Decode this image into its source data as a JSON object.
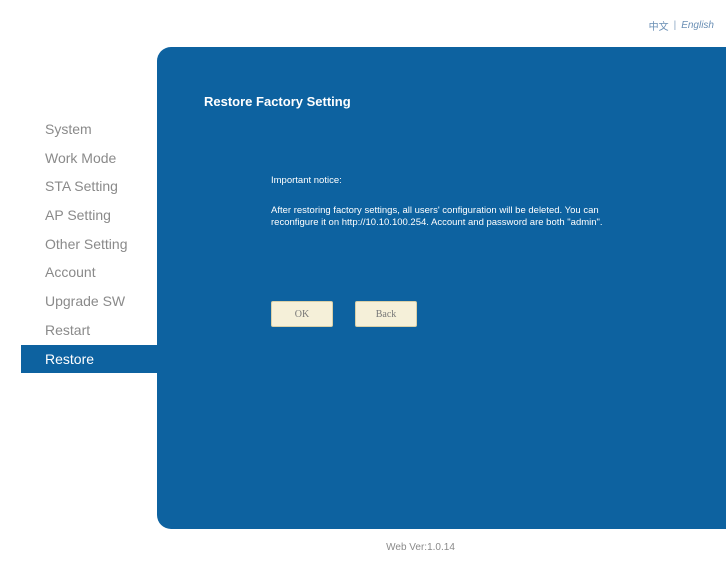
{
  "header": {
    "lang_zh": "中文",
    "separator": "|",
    "lang_en": "English"
  },
  "sidebar": {
    "items": [
      {
        "label": "System"
      },
      {
        "label": "Work Mode"
      },
      {
        "label": "STA Setting"
      },
      {
        "label": "AP Setting"
      },
      {
        "label": "Other Setting"
      },
      {
        "label": "Account"
      },
      {
        "label": "Upgrade SW"
      },
      {
        "label": "Restart"
      },
      {
        "label": "Restore"
      }
    ],
    "active_index": 8
  },
  "main": {
    "title": "Restore Factory Setting",
    "notice_title": "Important notice:",
    "notice_body": "After restoring factory settings, all users' configuration will be deleted. You can reconfigure it on http://10.10.100.254. Account and password are both \"admin\".",
    "ok_label": "OK",
    "back_label": "Back"
  },
  "footer": {
    "version": "Web Ver:1.0.14"
  },
  "colors": {
    "panel": "#0d62a0",
    "button_bg": "#f5f0d9",
    "nav_text": "#8a8a8a"
  }
}
